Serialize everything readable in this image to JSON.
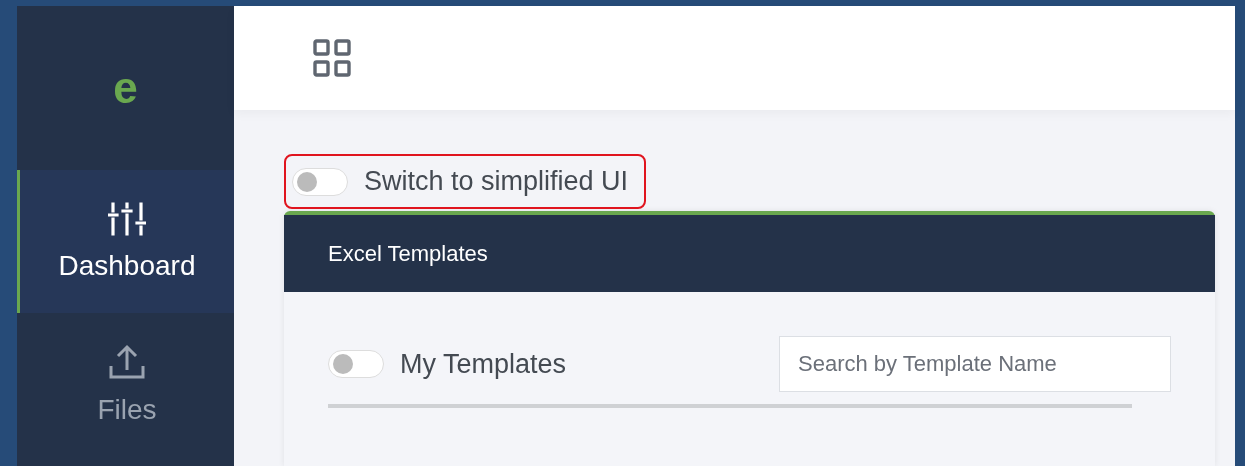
{
  "sidebar": {
    "logo": "e",
    "items": [
      {
        "kind": "sliders",
        "label": "Dashboard",
        "selected": true
      },
      {
        "kind": "upload",
        "label": "Files",
        "selected": false
      }
    ]
  },
  "simplified_toggle": {
    "label": "Switch to simplified UI",
    "on": false,
    "highlighted": true
  },
  "card": {
    "title": "Excel Templates",
    "my_templates_toggle": {
      "label": "My Templates",
      "on": false
    },
    "search": {
      "placeholder": "Search by Template Name"
    }
  }
}
